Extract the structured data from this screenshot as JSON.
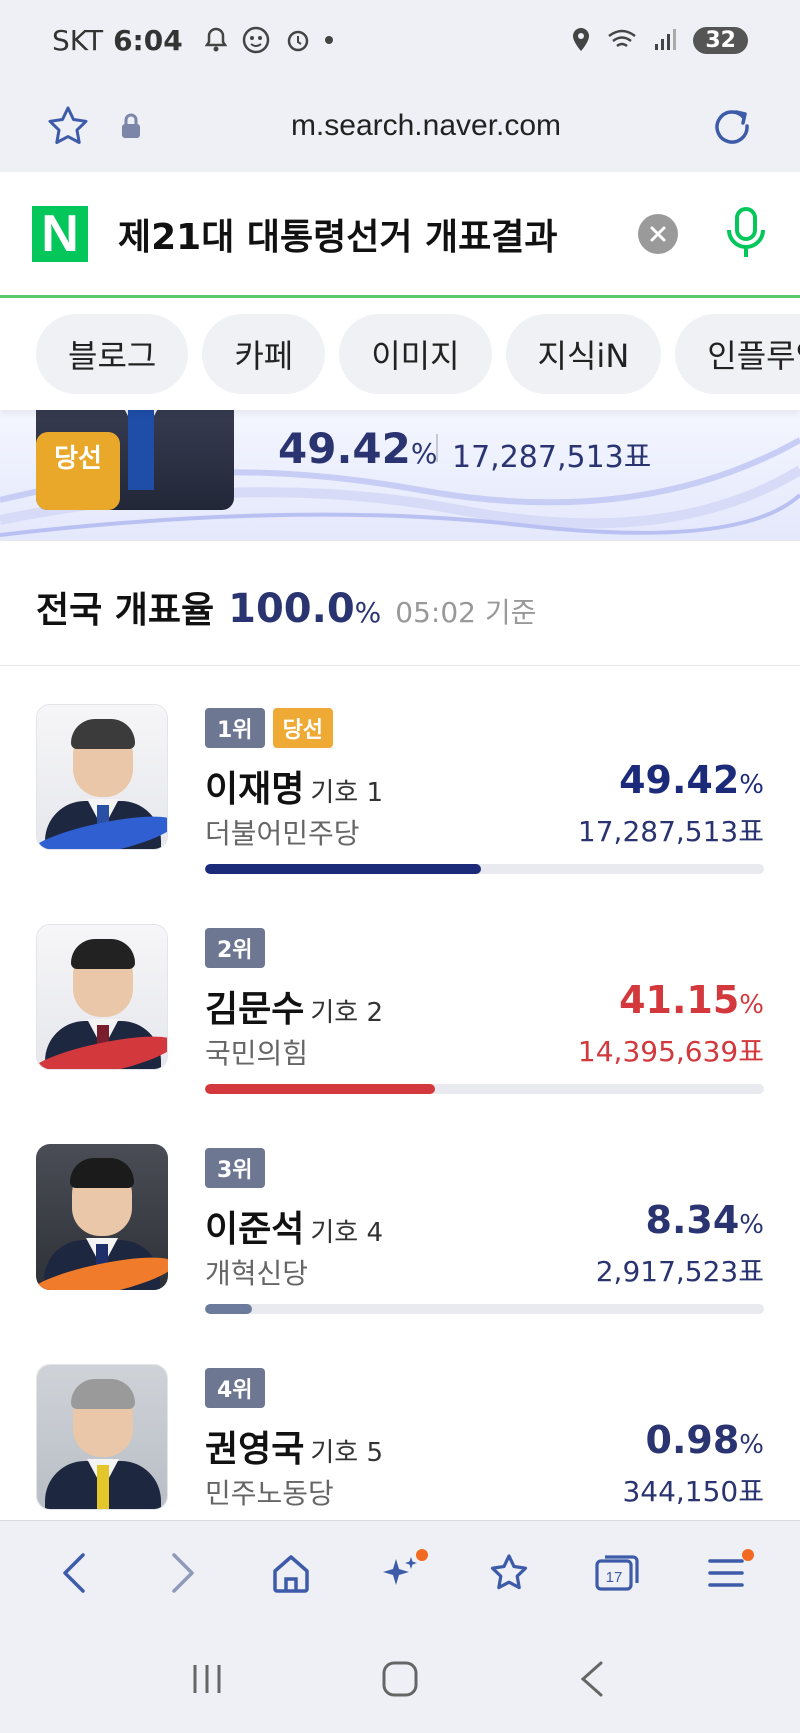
{
  "status_bar": {
    "carrier": "SKT",
    "time": "6:04",
    "battery": "32"
  },
  "browser": {
    "url": "m.search.naver.com"
  },
  "search": {
    "logo": "N",
    "query": "제21대 대통령선거 개표결과"
  },
  "tabs": [
    "블로그",
    "카페",
    "이미지",
    "지식iN",
    "인플루언서"
  ],
  "banner": {
    "elected_label": "당선",
    "pct": "49.42",
    "pct_unit": "%",
    "votes": "17,287,513표"
  },
  "count_rate": {
    "label": "전국 개표율",
    "value": "100.0",
    "unit": "%",
    "time": "05:02 기준"
  },
  "candidates": [
    {
      "rank": "1위",
      "elected": "당선",
      "name": "이재명",
      "number": "기호 1",
      "party": "더불어민주당",
      "pct": "49.42",
      "unit": "%",
      "votes": "17,287,513표",
      "share": 49.42,
      "color": "#1c2a7a"
    },
    {
      "rank": "2위",
      "name": "김문수",
      "number": "기호 2",
      "party": "국민의힘",
      "pct": "41.15",
      "unit": "%",
      "votes": "14,395,639표",
      "share": 41.15,
      "color": "#d2383c"
    },
    {
      "rank": "3위",
      "name": "이준석",
      "number": "기호 4",
      "party": "개혁신당",
      "pct": "8.34",
      "unit": "%",
      "votes": "2,917,523표",
      "share": 8.34,
      "color": "#6c7a9c"
    },
    {
      "rank": "4위",
      "name": "권영국",
      "number": "기호 5",
      "party": "민주노동당",
      "pct": "0.98",
      "unit": "%",
      "votes": "344,150표",
      "share": 0.98,
      "color": "#6c7a9c"
    }
  ],
  "bottom_nav": {
    "tabs_count": "17"
  },
  "colors": {
    "accent_navy": "#2a3470",
    "accent_red": "#d2383c",
    "naver_green": "#03c75a",
    "elected_gold": "#eeaa35"
  },
  "icons": [
    "bell-icon",
    "alarm-icon",
    "location-icon",
    "wifi-icon",
    "signal-icon",
    "star-icon",
    "lock-icon",
    "refresh-icon",
    "mic-icon",
    "back-icon",
    "forward-icon",
    "home-icon",
    "sparkle-icon",
    "favorites-icon",
    "tabs-icon",
    "menu-icon"
  ]
}
